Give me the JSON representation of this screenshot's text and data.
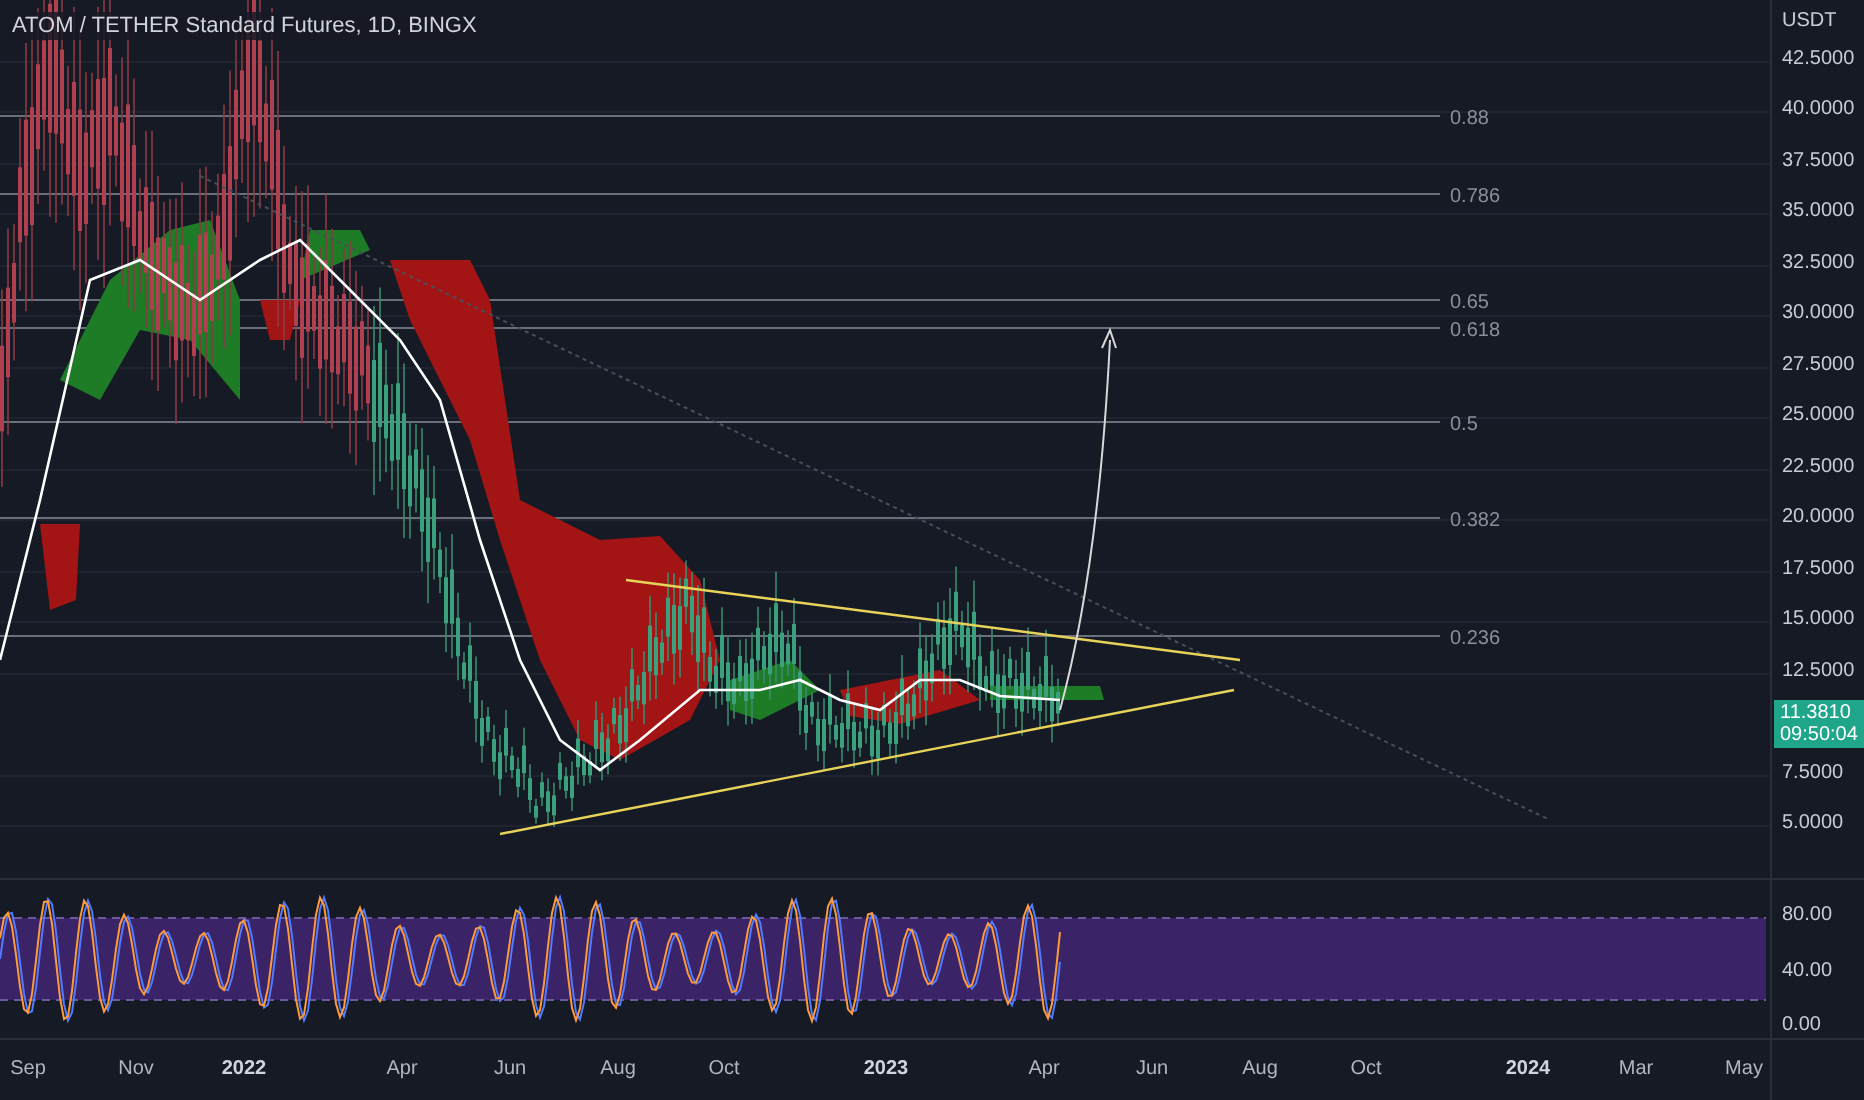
{
  "chart": {
    "title": "ATOM / TETHER Standard Futures, 1D, BINGX",
    "currency": "USDT",
    "price_ticks": [
      "42.5000",
      "40.0000",
      "37.5000",
      "35.0000",
      "32.5000",
      "30.0000",
      "27.5000",
      "25.0000",
      "22.5000",
      "20.0000",
      "17.5000",
      "15.0000",
      "12.5000",
      "7.5000",
      "5.0000"
    ],
    "fib_levels": [
      {
        "label": "0.88"
      },
      {
        "label": "0.786"
      },
      {
        "label": "0.65"
      },
      {
        "label": "0.618"
      },
      {
        "label": "0.5"
      },
      {
        "label": "0.382"
      },
      {
        "label": "0.236"
      }
    ],
    "last_price": {
      "price": "11.3810",
      "countdown": "09:50:04"
    }
  },
  "oscillator": {
    "ticks": [
      "80.00",
      "40.00",
      "0.00"
    ]
  },
  "time_axis": [
    {
      "label": "Sep",
      "kind": "month"
    },
    {
      "label": "Nov",
      "kind": "month"
    },
    {
      "label": "2022",
      "kind": "year"
    },
    {
      "label": "Apr",
      "kind": "month"
    },
    {
      "label": "Jun",
      "kind": "month"
    },
    {
      "label": "Aug",
      "kind": "month"
    },
    {
      "label": "Oct",
      "kind": "month"
    },
    {
      "label": "2023",
      "kind": "year"
    },
    {
      "label": "Apr",
      "kind": "month"
    },
    {
      "label": "Jun",
      "kind": "month"
    },
    {
      "label": "Aug",
      "kind": "month"
    },
    {
      "label": "Oct",
      "kind": "month"
    },
    {
      "label": "2024",
      "kind": "year"
    },
    {
      "label": "Mar",
      "kind": "month"
    },
    {
      "label": "May",
      "kind": "month"
    }
  ]
}
